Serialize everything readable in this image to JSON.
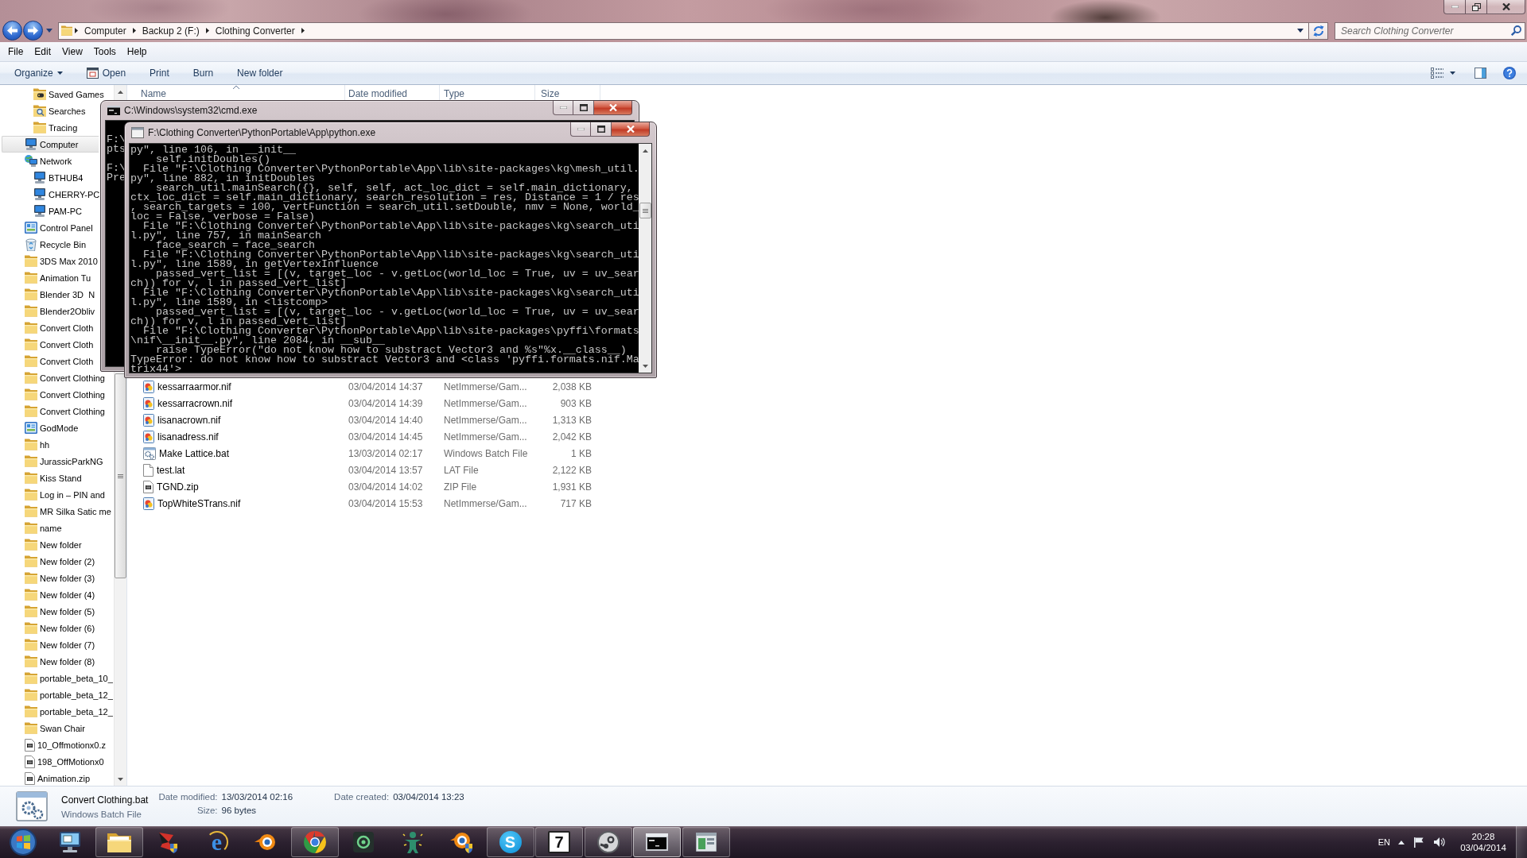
{
  "address_bar": {
    "path": [
      "Computer",
      "Backup 2 (F:)",
      "Clothing Converter"
    ]
  },
  "search": {
    "placeholder": "Search Clothing Converter"
  },
  "menu": [
    "File",
    "Edit",
    "View",
    "Tools",
    "Help"
  ],
  "toolbar": {
    "buttons": [
      {
        "label": "Organize",
        "kind": "menu"
      },
      {
        "label": "Open",
        "kind": "icon"
      },
      {
        "label": "Print",
        "kind": "plain"
      },
      {
        "label": "Burn",
        "kind": "plain"
      },
      {
        "label": "New folder",
        "kind": "plain"
      }
    ]
  },
  "navigation_pane": {
    "items": [
      {
        "children": [
          {
            "kind": "game_folder",
            "label": "Saved Games",
            "selected": false
          },
          {
            "kind": "search_folder",
            "label": "Searches",
            "selected": false
          },
          {
            "kind": "folder",
            "label": "Tracing",
            "selected": false
          }
        ]
      },
      {
        "kind": "computer",
        "label": "Computer",
        "selected": true
      },
      {
        "kind": "network",
        "label": "Network",
        "selected": false,
        "children": [
          {
            "kind": "pc",
            "label": "BTHUB4",
            "selected": false
          },
          {
            "kind": "pc",
            "label": "CHERRY-PC",
            "selected": false
          },
          {
            "kind": "pc",
            "label": "PAM-PC",
            "selected": false
          }
        ]
      },
      {
        "kind": "control_panel",
        "label": "Control Panel",
        "selected": false
      },
      {
        "kind": "recycle_bin",
        "label": "Recycle Bin",
        "selected": false
      },
      {
        "kind": "folder",
        "label": "3DS Max 2010",
        "selected": false
      },
      {
        "kind": "folder",
        "label": "Animation Tu",
        "selected": false
      },
      {
        "kind": "folder",
        "label": "Blender 3D  N",
        "selected": false
      },
      {
        "kind": "folder",
        "label": "Blender2Obliv",
        "selected": false
      },
      {
        "kind": "folder",
        "label": "Convert Cloth",
        "selected": false
      },
      {
        "kind": "folder",
        "label": "Convert Cloth",
        "selected": false
      },
      {
        "kind": "folder",
        "label": "Convert Cloth",
        "selected": false
      },
      {
        "kind": "folder",
        "label": "Convert Clothing",
        "selected": false
      },
      {
        "kind": "folder",
        "label": "Convert Clothing",
        "selected": false
      },
      {
        "kind": "folder",
        "label": "Convert Clothing",
        "selected": false
      },
      {
        "kind": "control_panel",
        "label": "GodMode",
        "selected": false
      },
      {
        "kind": "folder",
        "label": "hh",
        "selected": false
      },
      {
        "kind": "folder",
        "label": "JurassicParkNG",
        "selected": false
      },
      {
        "kind": "folder",
        "label": "Kiss Stand",
        "selected": false
      },
      {
        "kind": "folder",
        "label": "Log in – PIN and",
        "selected": false
      },
      {
        "kind": "folder",
        "label": "MR Silka Satic me",
        "selected": false
      },
      {
        "kind": "folder",
        "label": "name",
        "selected": false
      },
      {
        "kind": "folder",
        "label": "New folder",
        "selected": false
      },
      {
        "kind": "folder",
        "label": "New folder (2)",
        "selected": false
      },
      {
        "kind": "folder",
        "label": "New folder (3)",
        "selected": false
      },
      {
        "kind": "folder",
        "label": "New folder (4)",
        "selected": false
      },
      {
        "kind": "folder",
        "label": "New folder (5)",
        "selected": false
      },
      {
        "kind": "folder",
        "label": "New folder (6)",
        "selected": false
      },
      {
        "kind": "folder",
        "label": "New folder (7)",
        "selected": false
      },
      {
        "kind": "folder",
        "label": "New folder (8)",
        "selected": false
      },
      {
        "kind": "folder",
        "label": "portable_beta_10_",
        "selected": false
      },
      {
        "kind": "folder",
        "label": "portable_beta_12_",
        "selected": false
      },
      {
        "kind": "folder",
        "label": "portable_beta_12_",
        "selected": false
      },
      {
        "kind": "folder",
        "label": "Swan Chair",
        "selected": false
      },
      {
        "kind": "zip",
        "label": "10_Offmotionx0.z",
        "selected": false
      },
      {
        "kind": "zip",
        "label": "198_OffMotionx0",
        "selected": false
      },
      {
        "kind": "zip",
        "label": "Animation.zip",
        "selected": false
      }
    ]
  },
  "file_list": {
    "columns": [
      {
        "label": "Name",
        "sorted": true
      },
      {
        "label": "Date modified",
        "sorted": false
      },
      {
        "label": "Type",
        "sorted": false
      },
      {
        "label": "Size",
        "sorted": false
      }
    ],
    "rows": [
      {
        "kind": "nif",
        "name": "kessarraarmor.nif",
        "date_modified": "03/04/2014 14:37",
        "type": "NetImmerse/Gam...",
        "size": "2,038 KB"
      },
      {
        "kind": "nif",
        "name": "kessarracrown.nif",
        "date_modified": "03/04/2014 14:39",
        "type": "NetImmerse/Gam...",
        "size": "903 KB"
      },
      {
        "kind": "nif",
        "name": "lisanacrown.nif",
        "date_modified": "03/04/2014 14:40",
        "type": "NetImmerse/Gam...",
        "size": "1,313 KB"
      },
      {
        "kind": "nif",
        "name": "lisanadress.nif",
        "date_modified": "03/04/2014 14:45",
        "type": "NetImmerse/Gam...",
        "size": "2,042 KB"
      },
      {
        "kind": "bat",
        "name": "Make Lattice.bat",
        "date_modified": "13/03/2014 02:17",
        "type": "Windows Batch File",
        "size": "1 KB"
      },
      {
        "kind": "blank",
        "name": "test.lat",
        "date_modified": "03/04/2014 13:57",
        "type": "LAT File",
        "size": "2,122 KB"
      },
      {
        "kind": "zip",
        "name": "TGND.zip",
        "date_modified": "03/04/2014 14:02",
        "type": "ZIP File",
        "size": "1,931 KB"
      },
      {
        "kind": "nif",
        "name": "TopWhiteSTrans.nif",
        "date_modified": "03/04/2014 15:53",
        "type": "NetImmerse/Gam...",
        "size": "717 KB"
      }
    ]
  },
  "console_windows": [
    {
      "title": "C:\\Windows\\system32\\cmd.exe",
      "blocks": [
        [
          "F:\\",
          "pts"
        ],
        [
          "F:\\",
          "Pre"
        ]
      ]
    },
    {
      "title": "F:\\Clothing Converter\\PythonPortable\\App\\python.exe",
      "blocks": [
        [
          "py\", line 106, in __init__",
          "    self.initDoubles()",
          "  File \"F:\\Clothing Converter\\PythonPortable\\App\\lib\\site-packages\\kg\\mesh_util.",
          "py\", line 882, in initDoubles",
          "    search_util.mainSearch({}, self, self, act_loc_dict = self.main_dictionary,",
          "ctx_loc_dict = self.main_dictionary, search_resolution = res, Distance = 1 / res",
          ", search_targets = 100, vertFunction = search_util.setDouble, nmv = None, world_",
          "loc = False, verbose = False)",
          "  File \"F:\\Clothing Converter\\PythonPortable\\App\\lib\\site-packages\\kg\\search_uti",
          "l.py\", line 757, in mainSearch",
          "    face_search = face_search",
          "  File \"F:\\Clothing Converter\\PythonPortable\\App\\lib\\site-packages\\kg\\search_uti",
          "l.py\", line 1589, in getVertexInfluence",
          "    passed_vert_list = [(v, target_loc - v.getLoc(world_loc = True, uv = uv_sear",
          "ch)) for v, l in passed_vert_list]",
          "  File \"F:\\Clothing Converter\\PythonPortable\\App\\lib\\site-packages\\kg\\search_uti",
          "l.py\", line 1589, in <listcomp>",
          "    passed_vert_list = [(v, target_loc - v.getLoc(world_loc = True, uv = uv_sear",
          "ch)) for v, l in passed_vert_list]",
          "  File \"F:\\Clothing Converter\\PythonPortable\\App\\lib\\site-packages\\pyffi\\formats",
          "\\nif\\__init__.py\", line 2084, in __sub__",
          "    raise TypeError(\"do not know how to substract Vector3 and %s\"%x.__class__)",
          "TypeError: do not know how to substract Vector3 and <class 'pyffi.formats.nif.Ma",
          "trix44'>"
        ]
      ]
    }
  ],
  "details_pane": {
    "name": "Convert Clothing.bat",
    "type": "Windows Batch File",
    "property_columns": [
      [
        {
          "label": "Date modified:",
          "value": "13/03/2014 02:16"
        },
        {
          "label": "Size:",
          "value": "96 bytes"
        }
      ],
      [
        {
          "label": "Date created:",
          "value": "03/04/2014 13:23"
        }
      ]
    ]
  },
  "taskbar": {
    "items": [
      {
        "kind": "monitor",
        "running": false,
        "selected": false
      },
      {
        "kind": "folder",
        "running": true,
        "selected": false
      },
      {
        "kind": "shield",
        "running": false,
        "selected": false
      },
      {
        "kind": "glyph_ring",
        "glyph": "e",
        "running": false,
        "selected": false
      },
      {
        "kind": "ring",
        "running": false,
        "selected": false
      },
      {
        "kind": "tricolor",
        "running": true,
        "selected": false
      },
      {
        "kind": "dark_tile",
        "running": false,
        "selected": false
      },
      {
        "kind": "figure",
        "running": false,
        "selected": false
      },
      {
        "kind": "ring_shield",
        "running": false,
        "selected": false
      },
      {
        "kind": "glyph_circle",
        "glyph": "S",
        "running": true,
        "selected": false
      },
      {
        "kind": "glyph_box",
        "glyph": "7",
        "running": true,
        "selected": false
      },
      {
        "kind": "disc",
        "running": true,
        "selected": false
      },
      {
        "kind": "terminal",
        "running": true,
        "selected": true
      },
      {
        "kind": "green_window",
        "running": true,
        "selected": false
      }
    ],
    "tray": {
      "language": "EN",
      "time": "20:28",
      "date": "03/04/2014"
    }
  }
}
